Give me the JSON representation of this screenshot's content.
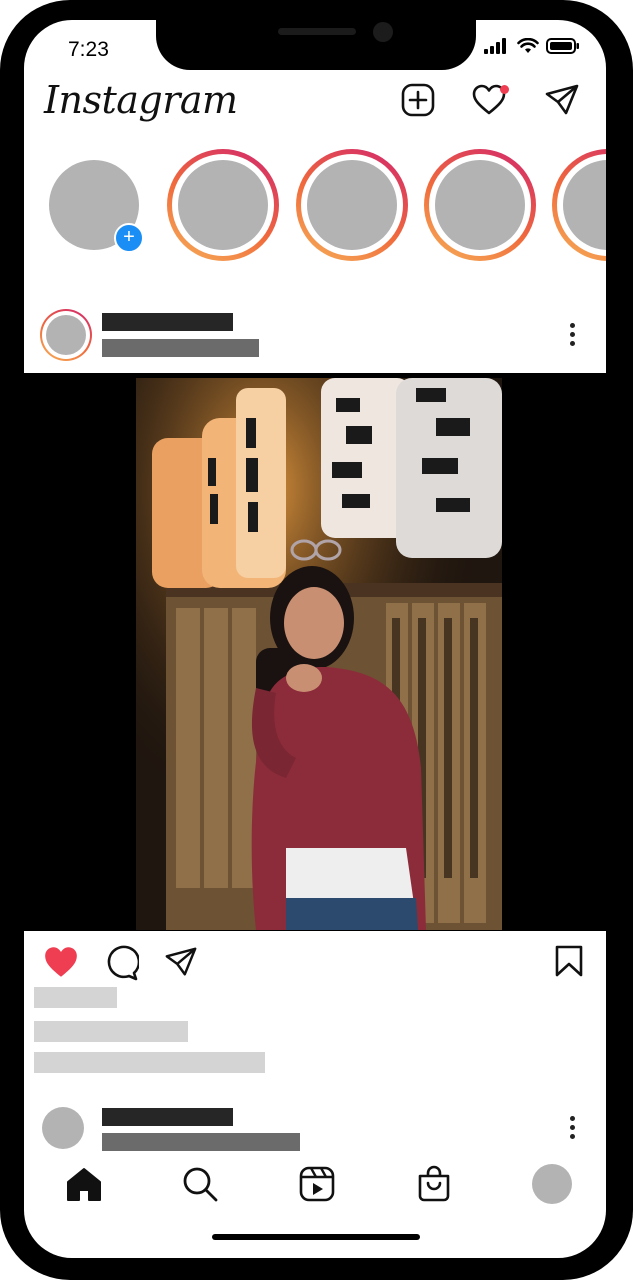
{
  "status_bar": {
    "time": "7:23"
  },
  "header": {
    "logo_text": "Instagram",
    "icons": [
      "new-post-icon",
      "heart-icon",
      "direct-message-icon"
    ],
    "notification_dot_color": "#ef3d52"
  },
  "stories": {
    "count_visible": 5,
    "ring_colors": [
      "#f6b25a",
      "#f06b3c",
      "#d1246e"
    ],
    "add_badge_symbol": "+",
    "add_badge_color": "#1b8ef6"
  },
  "post": {
    "menu_icon": "kebab-icon",
    "liked": true,
    "like_color": "#ef3d52",
    "action_icons": [
      "heart-icon",
      "comment-icon",
      "share-icon",
      "bookmark-icon"
    ]
  },
  "tab_bar": {
    "tabs": [
      "home-icon",
      "search-icon",
      "reels-icon",
      "shop-icon",
      "profile-avatar"
    ]
  }
}
